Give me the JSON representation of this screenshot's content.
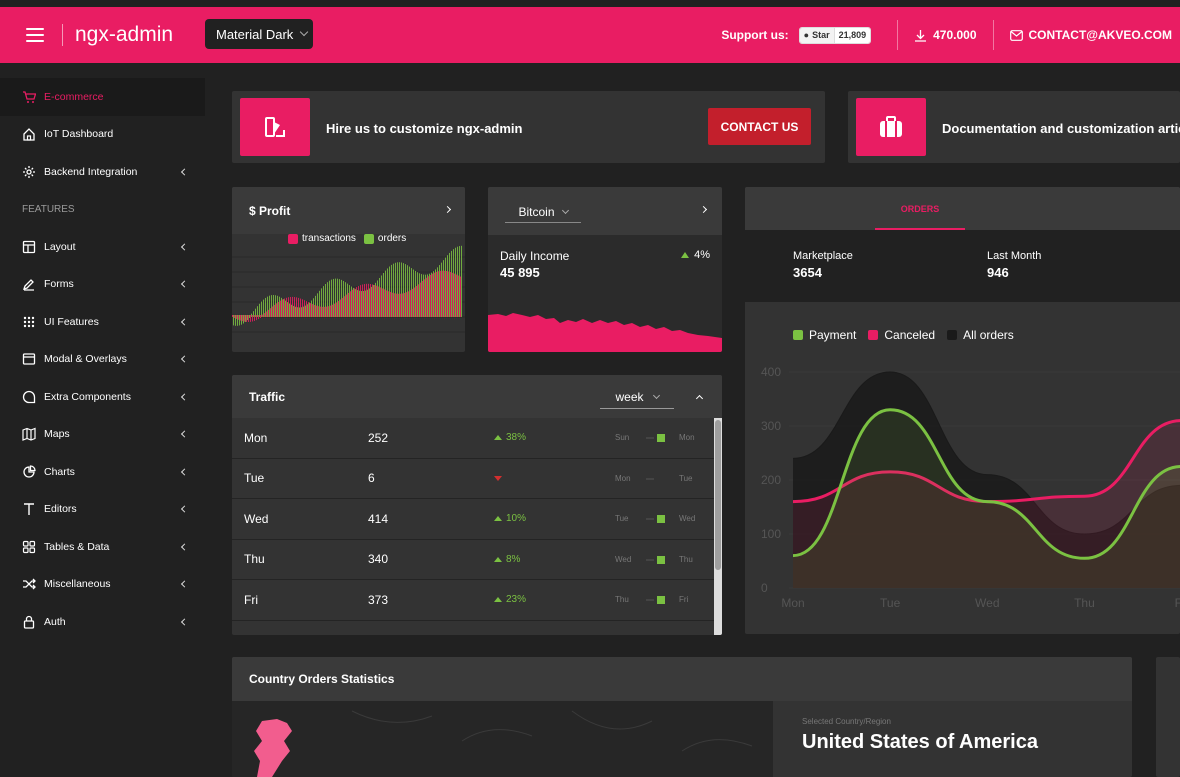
{
  "header": {
    "logo": "ngx-admin",
    "theme": "Material Dark",
    "support_label": "Support us:",
    "github_star": "Star",
    "github_count": "21,809",
    "downloads": "470.000",
    "contact": "CONTACT@AKVEO.COM"
  },
  "sidebar": {
    "items": [
      {
        "label": "E-commerce",
        "icon": "cart-icon",
        "active": true
      },
      {
        "label": "IoT Dashboard",
        "icon": "home-icon"
      },
      {
        "label": "Backend Integration",
        "icon": "gear-icon"
      },
      {
        "label": "FEATURES",
        "heading": true
      },
      {
        "label": "Layout",
        "icon": "layout-icon"
      },
      {
        "label": "Forms",
        "icon": "pen-icon"
      },
      {
        "label": "UI Features",
        "icon": "grid-icon"
      },
      {
        "label": "Modal & Overlays",
        "icon": "window-icon"
      },
      {
        "label": "Extra Components",
        "icon": "chat-icon"
      },
      {
        "label": "Maps",
        "icon": "map-icon"
      },
      {
        "label": "Charts",
        "icon": "pie-chart-icon"
      },
      {
        "label": "Editors",
        "icon": "text-icon"
      },
      {
        "label": "Tables & Data",
        "icon": "table-icon"
      },
      {
        "label": "Miscellaneous",
        "icon": "shuffle-icon"
      },
      {
        "label": "Auth",
        "icon": "lock-icon"
      }
    ]
  },
  "promo": {
    "hire_text": "Hire us to customize ngx-admin",
    "contact_button": "CONTACT US",
    "docs_text": "Documentation and customization artic"
  },
  "profit": {
    "title": "$ Profit",
    "legend": [
      "transactions",
      "orders"
    ]
  },
  "bitcoin": {
    "currency": "Bitcoin",
    "daily_label": "Daily Income",
    "daily_value": "45 895",
    "change": "4%"
  },
  "traffic": {
    "title": "Traffic",
    "period": "week",
    "rows": [
      {
        "day": "Mon",
        "value": "252",
        "delta": "38%",
        "up": true,
        "prev": "Sun",
        "cur": "Mon"
      },
      {
        "day": "Tue",
        "value": "6",
        "delta": "",
        "up": false,
        "prev": "Mon",
        "cur": "Tue"
      },
      {
        "day": "Wed",
        "value": "414",
        "delta": "10%",
        "up": true,
        "prev": "Tue",
        "cur": "Wed"
      },
      {
        "day": "Thu",
        "value": "340",
        "delta": "8%",
        "up": true,
        "prev": "Wed",
        "cur": "Thu"
      },
      {
        "day": "Fri",
        "value": "373",
        "delta": "23%",
        "up": true,
        "prev": "Thu",
        "cur": "Fri"
      }
    ]
  },
  "orders": {
    "tab": "ORDERS",
    "stats": [
      {
        "label": "Marketplace",
        "value": "3654"
      },
      {
        "label": "Last Month",
        "value": "946"
      }
    ],
    "legend": [
      "Payment",
      "Canceled",
      "All orders"
    ]
  },
  "chart_data": {
    "type": "area",
    "x": [
      "Mon",
      "Tue",
      "Wed",
      "Thu",
      "Fri"
    ],
    "ylim": [
      0,
      400
    ],
    "yticks": [
      "400",
      "300",
      "200",
      "100",
      "0"
    ],
    "series": [
      {
        "name": "All orders",
        "color": "#1a1a1a",
        "values": [
          240,
          400,
          210,
          100,
          190
        ]
      },
      {
        "name": "Canceled",
        "color": "#e91d63",
        "values": [
          160,
          215,
          160,
          170,
          310
        ]
      },
      {
        "name": "Payment",
        "color": "#7bc142",
        "values": [
          60,
          330,
          160,
          55,
          225
        ]
      }
    ]
  },
  "country": {
    "title": "Country Orders Statistics",
    "selected_label": "Selected Country/Region",
    "selected_country": "United States of America"
  }
}
